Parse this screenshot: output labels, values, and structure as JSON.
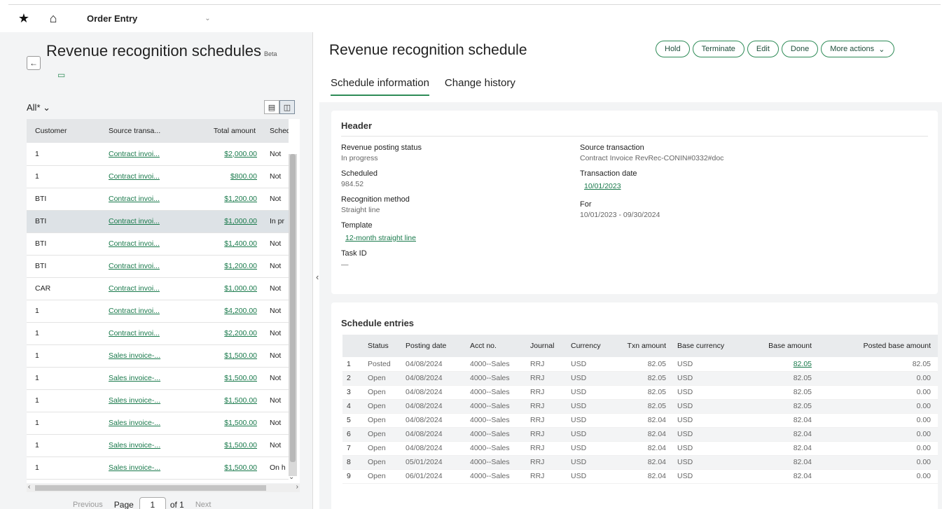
{
  "topbar": {
    "app_name": "Order Entry"
  },
  "list": {
    "title": "Revenue recognition schedules",
    "beta": "Beta",
    "filter": "All*",
    "columns": [
      "Customer",
      "Source transa...",
      "Total amount",
      "Schedu"
    ],
    "rows": [
      {
        "customer": "1",
        "source": "Contract invoi...",
        "total": "$2,000.00",
        "schedule": "Not"
      },
      {
        "customer": "1",
        "source": "Contract invoi...",
        "total": "$800.00",
        "schedule": "Not"
      },
      {
        "customer": "BTI",
        "source": "Contract invoi...",
        "total": "$1,200.00",
        "schedule": "Not"
      },
      {
        "customer": "BTI",
        "source": "Contract invoi...",
        "total": "$1,000.00",
        "schedule": "In pr"
      },
      {
        "customer": "BTI",
        "source": "Contract invoi...",
        "total": "$1,400.00",
        "schedule": "Not"
      },
      {
        "customer": "BTI",
        "source": "Contract invoi...",
        "total": "$1,200.00",
        "schedule": "Not"
      },
      {
        "customer": "CAR",
        "source": "Contract invoi...",
        "total": "$1,000.00",
        "schedule": "Not"
      },
      {
        "customer": "1",
        "source": "Contract invoi...",
        "total": "$4,200.00",
        "schedule": "Not"
      },
      {
        "customer": "1",
        "source": "Contract invoi...",
        "total": "$2,200.00",
        "schedule": "Not"
      },
      {
        "customer": "1",
        "source": "Sales invoice-...",
        "total": "$1,500.00",
        "schedule": "Not"
      },
      {
        "customer": "1",
        "source": "Sales invoice-...",
        "total": "$1,500.00",
        "schedule": "Not"
      },
      {
        "customer": "1",
        "source": "Sales invoice-...",
        "total": "$1,500.00",
        "schedule": "Not"
      },
      {
        "customer": "1",
        "source": "Sales invoice-...",
        "total": "$1,500.00",
        "schedule": "Not"
      },
      {
        "customer": "1",
        "source": "Sales invoice-...",
        "total": "$1,500.00",
        "schedule": "Not"
      },
      {
        "customer": "1",
        "source": "Sales invoice-...",
        "total": "$1,500.00",
        "schedule": "On h"
      }
    ],
    "selected_row": 3,
    "pager": {
      "previous": "Previous",
      "page_label": "Page",
      "page": "1",
      "of": "of 1",
      "next": "Next"
    }
  },
  "detail": {
    "title": "Revenue recognition schedule",
    "actions": [
      "Hold",
      "Terminate",
      "Edit",
      "Done",
      "More actions"
    ],
    "tabs": [
      "Schedule information",
      "Change history"
    ],
    "active_tab": 0,
    "header": {
      "title": "Header",
      "revenue_posting_status_label": "Revenue posting status",
      "revenue_posting_status": "In progress",
      "scheduled_label": "Scheduled",
      "scheduled": "984.52",
      "recognition_method_label": "Recognition method",
      "recognition_method": "Straight line",
      "template_label": "Template",
      "template": "12-month straight line",
      "task_id_label": "Task ID",
      "task_id": "—",
      "source_transaction_label": "Source transaction",
      "source_transaction": "Contract Invoice RevRec-CONIN#0332#doc",
      "transaction_date_label": "Transaction date",
      "transaction_date": "10/01/2023",
      "for_label": "For",
      "for": "10/01/2023 - 09/30/2024"
    },
    "entries": {
      "title": "Schedule entries",
      "columns": [
        "",
        "Status",
        "Posting date",
        "Acct no.",
        "Journal",
        "Currency",
        "Txn amount",
        "Base currency",
        "Base amount",
        "Posted base amount"
      ],
      "rows": [
        [
          "1",
          "Posted",
          "04/08/2024",
          "4000--Sales",
          "RRJ",
          "USD",
          "82.05",
          "USD",
          "82.05",
          "82.05"
        ],
        [
          "2",
          "Open",
          "04/08/2024",
          "4000--Sales",
          "RRJ",
          "USD",
          "82.05",
          "USD",
          "82.05",
          "0.00"
        ],
        [
          "3",
          "Open",
          "04/08/2024",
          "4000--Sales",
          "RRJ",
          "USD",
          "82.05",
          "USD",
          "82.05",
          "0.00"
        ],
        [
          "4",
          "Open",
          "04/08/2024",
          "4000--Sales",
          "RRJ",
          "USD",
          "82.05",
          "USD",
          "82.05",
          "0.00"
        ],
        [
          "5",
          "Open",
          "04/08/2024",
          "4000--Sales",
          "RRJ",
          "USD",
          "82.04",
          "USD",
          "82.04",
          "0.00"
        ],
        [
          "6",
          "Open",
          "04/08/2024",
          "4000--Sales",
          "RRJ",
          "USD",
          "82.04",
          "USD",
          "82.04",
          "0.00"
        ],
        [
          "7",
          "Open",
          "04/08/2024",
          "4000--Sales",
          "RRJ",
          "USD",
          "82.04",
          "USD",
          "82.04",
          "0.00"
        ],
        [
          "8",
          "Open",
          "05/01/2024",
          "4000--Sales",
          "RRJ",
          "USD",
          "82.04",
          "USD",
          "82.04",
          "0.00"
        ],
        [
          "9",
          "Open",
          "06/01/2024",
          "4000--Sales",
          "RRJ",
          "USD",
          "82.04",
          "USD",
          "82.04",
          "0.00"
        ]
      ]
    }
  },
  "colors": {
    "accent": "#2e8b57",
    "link": "#1a7a4c"
  }
}
